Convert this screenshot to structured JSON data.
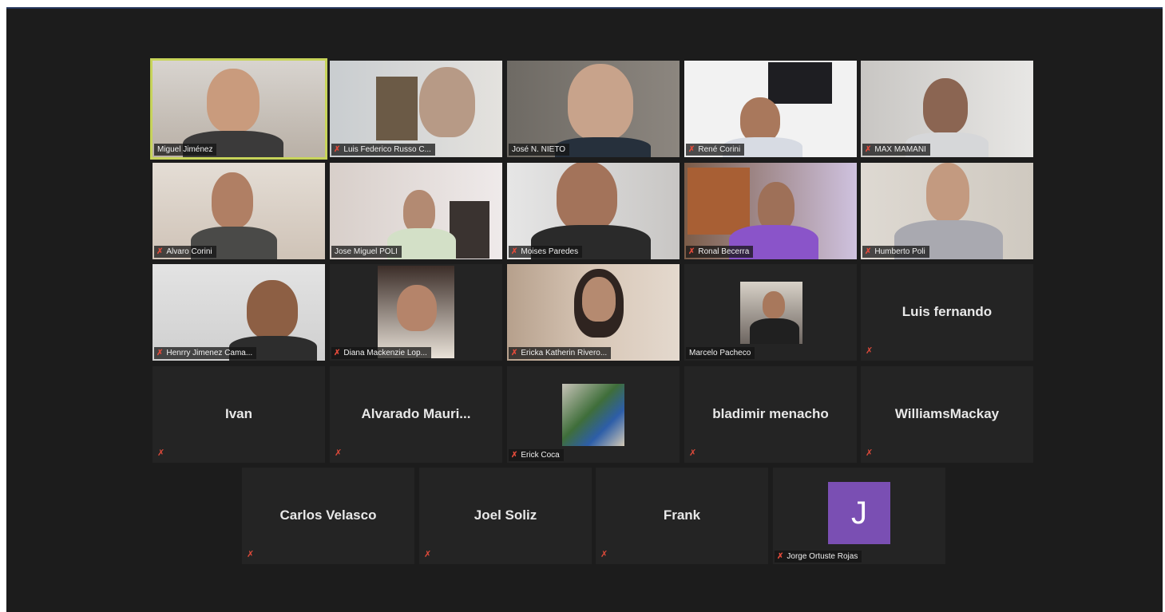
{
  "meeting": {
    "participants": [
      {
        "name": "Miguel Jiménez",
        "muted": false,
        "active": true,
        "video": true
      },
      {
        "name": "Luis Federico Russo C...",
        "muted": true,
        "video": true
      },
      {
        "name": "José N. NIETO",
        "muted": false,
        "video": true
      },
      {
        "name": "René Corini",
        "muted": true,
        "video": true
      },
      {
        "name": "MAX MAMANI",
        "muted": true,
        "video": true
      },
      {
        "name": "Alvaro Corini",
        "muted": true,
        "video": true
      },
      {
        "name": "Jose Miguel POLI",
        "muted": false,
        "video": true
      },
      {
        "name": "Moises Paredes",
        "muted": true,
        "video": true
      },
      {
        "name": "Ronal Becerra",
        "muted": true,
        "video": true
      },
      {
        "name": "Humberto Poli",
        "muted": true,
        "video": true
      },
      {
        "name": "Henrry Jimenez Cama...",
        "muted": true,
        "video": true
      },
      {
        "name": "Diana Mackenzie Lop...",
        "muted": true,
        "video": true
      },
      {
        "name": "Ericka Katherin Rivero...",
        "muted": true,
        "video": true
      },
      {
        "name": "Marcelo Pacheco",
        "muted": false,
        "video": true
      },
      {
        "name": "Luis fernando",
        "muted": true,
        "video": false
      },
      {
        "name": "Ivan",
        "muted": true,
        "video": false
      },
      {
        "name": "Alvarado  Mauri...",
        "muted": true,
        "video": false
      },
      {
        "name": "Erick Coca",
        "muted": true,
        "video": true
      },
      {
        "name": "bladimir menacho",
        "muted": true,
        "video": false
      },
      {
        "name": "WilliamsMackay",
        "muted": true,
        "video": false
      },
      {
        "name": "Carlos Velasco",
        "muted": true,
        "video": false
      },
      {
        "name": "Joel Soliz",
        "muted": true,
        "video": false
      },
      {
        "name": "Frank",
        "muted": true,
        "video": false
      },
      {
        "name": "Jorge Ortuste Rojas",
        "muted": true,
        "video": false,
        "avatar_letter": "J"
      }
    ]
  },
  "icons": {
    "mute": "microphone-muted-icon"
  },
  "colors": {
    "active_border": "#c7d45a",
    "mute_red": "#e04a3a",
    "avatar_purple": "#7a4fb3",
    "background": "#1c1c1c"
  }
}
